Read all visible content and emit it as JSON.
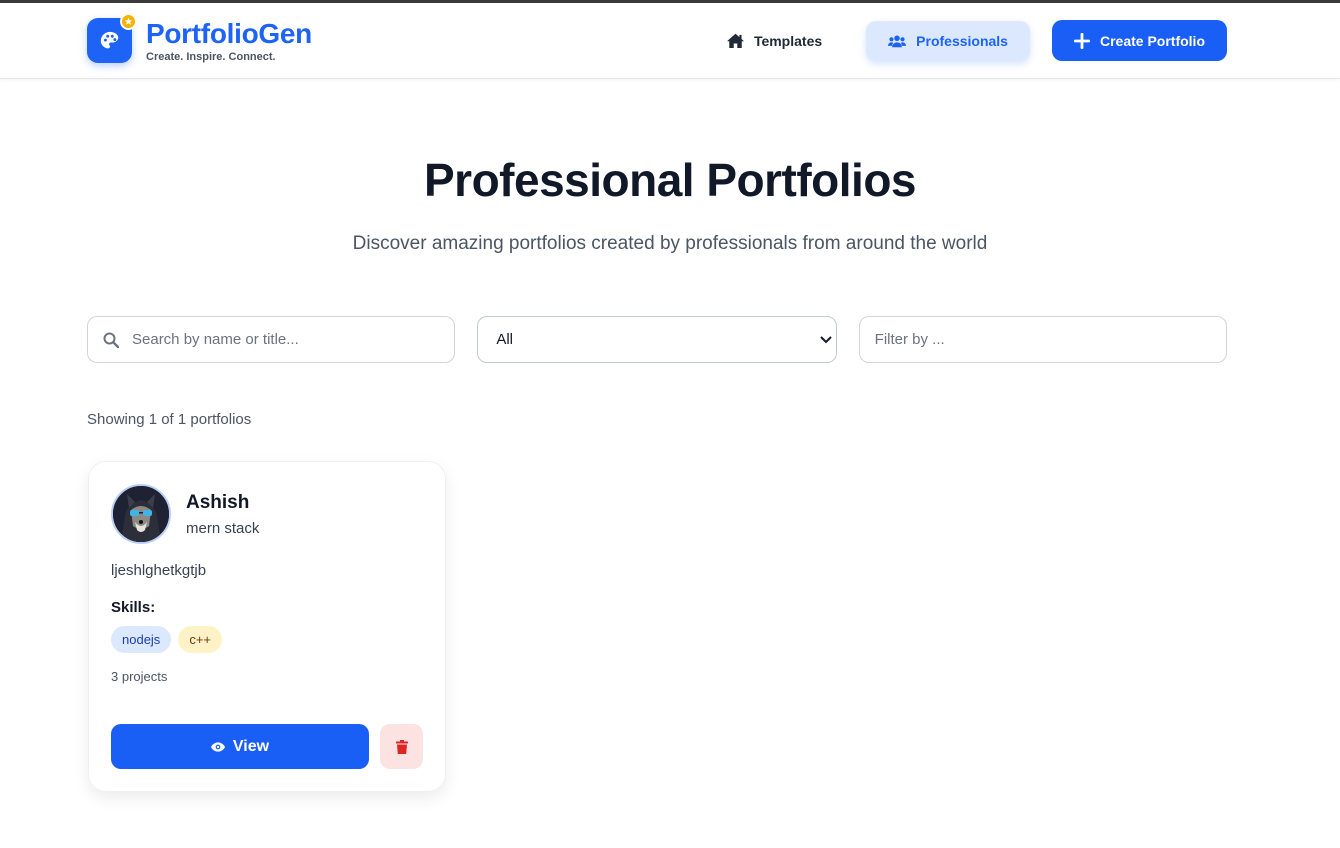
{
  "brand": {
    "name": "PortfolioGen",
    "tagline": "Create. Inspire. Connect.",
    "logo_icon": "palette-icon",
    "badge_icon": "star-icon",
    "color": "#1d63f5"
  },
  "nav": {
    "templates": "Templates",
    "professionals": "Professionals",
    "create": "Create Portfolio",
    "active": "professionals"
  },
  "hero": {
    "title": "Professional Portfolios",
    "subtitle": "Discover amazing portfolios created by professionals from around the world"
  },
  "filters": {
    "search_placeholder": "Search by name or title...",
    "category_value": "All",
    "filter_placeholder": "Filter by ..."
  },
  "results": {
    "count_text": "Showing 1 of 1 portfolios"
  },
  "portfolios": [
    {
      "name": "Ashish",
      "title": "mern stack",
      "description": "ljeshlghetkgtjb",
      "skills_label": "Skills:",
      "skills": [
        "nodejs",
        "c++"
      ],
      "projects": "3 projects",
      "view_label": "View"
    }
  ],
  "colors": {
    "primary": "#1a5ff5",
    "danger": "#dc2626",
    "danger_bg": "#fde2e2"
  }
}
